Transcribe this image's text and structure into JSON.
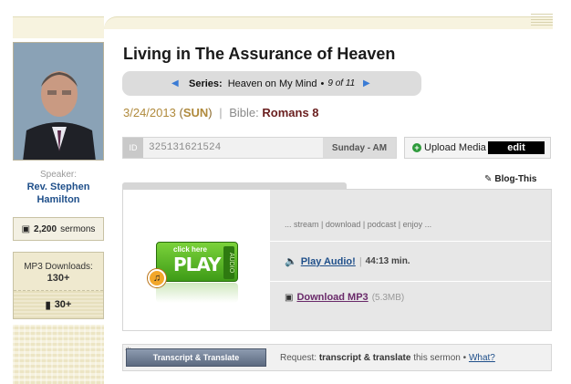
{
  "sidebar": {
    "speaker_label": "Speaker:",
    "speaker_name": "Rev. Stephen Hamilton",
    "sermons_count": "2,200",
    "sermons_label": "sermons",
    "mp3_label": "MP3 Downloads:",
    "mp3_count": "130+",
    "mobile_count": "30+"
  },
  "main": {
    "title": "Living in The Assurance of Heaven",
    "series": {
      "label": "Series:",
      "name": "Heaven on My Mind",
      "dot": "•",
      "position": "9 of 11"
    },
    "date": "3/24/2013",
    "day": "SUN",
    "bible_label": "Bible:",
    "bible_ref": "Romans 8",
    "id_tag": "ID",
    "id_value": "325131621524",
    "event": "Sunday - AM",
    "upload_label": "Upload Media",
    "edit_label": "edit",
    "blog_this": "Blog-This",
    "player": {
      "click_here": "click here",
      "play": "PLAY",
      "audio": "AUDIO",
      "stream_row": "... stream | download | podcast | enjoy ...",
      "play_audio": "Play Audio!",
      "duration": "44:13 min.",
      "download": "Download MP3",
      "size": "(5.3MB)"
    },
    "transcript": {
      "button": "Transcript & Translate",
      "request_prefix": "Request:",
      "request_bold": "transcript & translate",
      "request_suffix": "this sermon •",
      "what": "What?"
    }
  },
  "colors": {
    "accent_link": "#1f4f8a",
    "date_gold": "#b08a3c",
    "bible_ref": "#6a1f1f",
    "play_green": "#3e9b17",
    "download_purple": "#6a2a6a"
  }
}
